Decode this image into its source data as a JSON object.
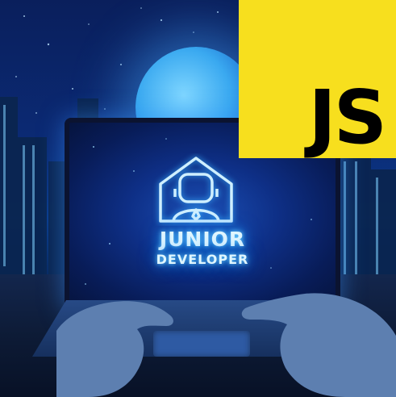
{
  "screen": {
    "title_line1": "JUNIOR",
    "title_line2": "DEVELOPER",
    "logo_icon": "developer-house-icon"
  },
  "badge": {
    "text": "JS",
    "background": "#f7df1e",
    "text_color": "#000000"
  },
  "colors": {
    "glow": "#2aa8ff",
    "sky": "#0b2a74"
  }
}
